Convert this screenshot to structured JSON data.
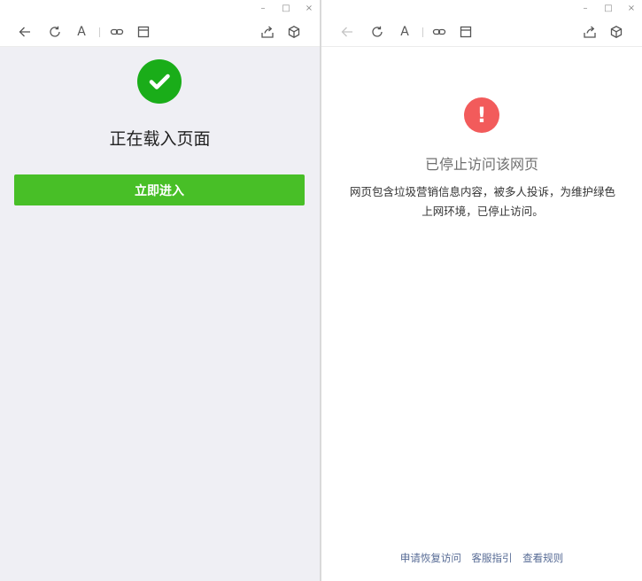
{
  "window_controls": {
    "minimize": "–",
    "maximize": "□",
    "close": "×"
  },
  "toolbar": {
    "icons": [
      "back-arrow-icon",
      "refresh-icon",
      "font-size-icon",
      "link-icon",
      "window-icon",
      "share-icon",
      "cube-icon"
    ],
    "font_glyph": "A"
  },
  "left": {
    "icon": "checkmark-icon",
    "title": "正在载入页面",
    "enter_button": "立即进入",
    "colors": {
      "success": "#1aad19",
      "button": "#48bf27",
      "background": "#efeff4"
    }
  },
  "right": {
    "icon": "exclamation-icon",
    "icon_glyph": "!",
    "title": "已停止访问该网页",
    "description": "网页包含垃圾营销信息内容，被多人投诉，为维护绿色上网环境，已停止访问。",
    "footer_links": [
      "申请恢复访问",
      "客服指引",
      "查看规则"
    ],
    "colors": {
      "warning": "#f25b5b",
      "link": "#576b95"
    }
  }
}
